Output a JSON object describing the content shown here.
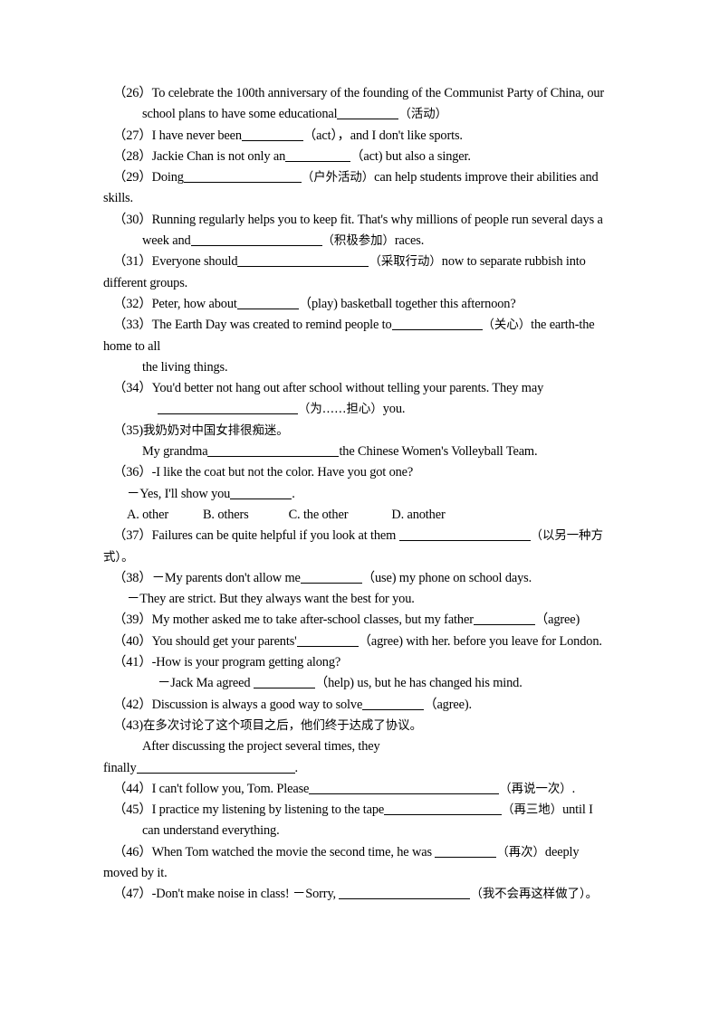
{
  "document": {
    "type": "english-grammar-worksheet",
    "page_background": "#ffffff",
    "text_color": "#000000"
  },
  "items": [
    {
      "number": "（26）",
      "lines": [
        {
          "indent": "ind1",
          "segments": [
            {
              "t": "text",
              "v": "（26）To celebrate the 100th anniversary of the founding of the Communist Party of China, our"
            }
          ]
        },
        {
          "indent": "ind2",
          "segments": [
            {
              "t": "text",
              "v": "school plans to have some educational"
            },
            {
              "t": "blank",
              "w": "b68"
            },
            {
              "t": "cn",
              "v": "（活动）"
            }
          ]
        }
      ]
    },
    {
      "number": "（27）",
      "lines": [
        {
          "indent": "ind1",
          "segments": [
            {
              "t": "text",
              "v": "（27）I have never been"
            },
            {
              "t": "blank",
              "w": "b68"
            },
            {
              "t": "text",
              "v": "（act），and I don't like sports."
            }
          ]
        }
      ]
    },
    {
      "number": "（28）",
      "lines": [
        {
          "indent": "ind1",
          "segments": [
            {
              "t": "text",
              "v": "（28）Jackie Chan is not only an"
            },
            {
              "t": "blank",
              "w": "b72"
            },
            {
              "t": "text",
              "v": "（act) but also a singer."
            }
          ]
        }
      ]
    },
    {
      "number": "（29）",
      "lines": [
        {
          "indent": "ind1",
          "segments": [
            {
              "t": "text",
              "v": "（29）Doing"
            },
            {
              "t": "blank",
              "w": "b130"
            },
            {
              "t": "cn",
              "v": "（户外活动）"
            },
            {
              "t": "text",
              "v": "can help students improve their abilities and"
            }
          ]
        },
        {
          "indent": "ind0",
          "segments": [
            {
              "t": "text",
              "v": "skills."
            }
          ]
        }
      ]
    },
    {
      "number": "（30）",
      "lines": [
        {
          "indent": "ind1",
          "segments": [
            {
              "t": "text",
              "v": "（30）Running regularly helps you to keep fit. That's why millions of people run several days a"
            }
          ]
        },
        {
          "indent": "ind2",
          "segments": [
            {
              "t": "text",
              "v": "week and"
            },
            {
              "t": "blank",
              "w": "b145"
            },
            {
              "t": "cn",
              "v": "（积极参加）"
            },
            {
              "t": "text",
              "v": "races."
            }
          ]
        }
      ]
    },
    {
      "number": "（31）",
      "lines": [
        {
          "indent": "ind1",
          "segments": [
            {
              "t": "text",
              "v": "（31）Everyone should"
            },
            {
              "t": "blank",
              "w": "b145"
            },
            {
              "t": "cn",
              "v": "（采取行动）"
            },
            {
              "t": "text",
              "v": "now to separate rubbish into"
            }
          ]
        },
        {
          "indent": "ind0",
          "segments": [
            {
              "t": "text",
              "v": "different groups."
            }
          ]
        }
      ]
    },
    {
      "number": "（32）",
      "lines": [
        {
          "indent": "ind1",
          "segments": [
            {
              "t": "text",
              "v": "（32）Peter, how about"
            },
            {
              "t": "blank",
              "w": "b68"
            },
            {
              "t": "text",
              "v": "（play) basketball together this afternoon?"
            }
          ]
        }
      ]
    },
    {
      "number": "（33）",
      "lines": [
        {
          "indent": "ind1",
          "segments": [
            {
              "t": "text",
              "v": "（33）The Earth Day was created to remind people to"
            },
            {
              "t": "blank",
              "w": "b100"
            },
            {
              "t": "cn",
              "v": "（关心）"
            },
            {
              "t": "text",
              "v": "the earth-the"
            }
          ]
        },
        {
          "indent": "ind0",
          "segments": [
            {
              "t": "text",
              "v": "home to all"
            }
          ]
        },
        {
          "indent": "ind2",
          "segments": [
            {
              "t": "text",
              "v": "the living things."
            }
          ]
        }
      ]
    },
    {
      "number": "（34）",
      "lines": [
        {
          "indent": "ind1",
          "segments": [
            {
              "t": "text",
              "v": "（34）You'd better not hang out after school without telling your parents. They may"
            }
          ]
        },
        {
          "indent": "ind3",
          "segments": [
            {
              "t": "blank",
              "w": "b155"
            },
            {
              "t": "cn",
              "v": "（为……担心）"
            },
            {
              "t": "text",
              "v": "you."
            }
          ]
        }
      ]
    },
    {
      "number": "（35）",
      "lines": [
        {
          "indent": "ind1",
          "segments": [
            {
              "t": "text",
              "v": "（35)"
            },
            {
              "t": "cn",
              "v": "我奶奶对中国女排很痴迷。"
            }
          ]
        },
        {
          "indent": "ind2",
          "segments": [
            {
              "t": "text",
              "v": "My grandma"
            },
            {
              "t": "blank",
              "w": "b145"
            },
            {
              "t": "text",
              "v": "the Chinese Women's Volleyball Team."
            }
          ]
        }
      ]
    },
    {
      "number": "（36）",
      "lines": [
        {
          "indent": "ind1",
          "segments": [
            {
              "t": "text",
              "v": "（36）-I like the coat but not the color. Have you got one?"
            }
          ]
        },
        {
          "indent": "ind4",
          "segments": [
            {
              "t": "text",
              "v": "－Yes, I'll show you"
            },
            {
              "t": "blank",
              "w": "b68"
            },
            {
              "t": "text",
              "v": "."
            }
          ]
        },
        {
          "indent": "ind4",
          "segments": [
            {
              "t": "text",
              "v": "A. other"
            },
            {
              "t": "gap",
              "w": "opt-gap"
            },
            {
              "t": "text",
              "v": "B. others"
            },
            {
              "t": "gap",
              "w": "opt-gap2"
            },
            {
              "t": "text",
              "v": "C. the other"
            },
            {
              "t": "gap",
              "w": "opt-gap3"
            },
            {
              "t": "text",
              "v": "D. another"
            }
          ]
        }
      ]
    },
    {
      "number": "（37）",
      "lines": [
        {
          "indent": "ind1",
          "segments": [
            {
              "t": "text",
              "v": "（37）Failures can be quite helpful if you look at them "
            },
            {
              "t": "blank",
              "w": "b145"
            },
            {
              "t": "cn",
              "v": "（以另一种方"
            }
          ]
        },
        {
          "indent": "ind0",
          "segments": [
            {
              "t": "cn",
              "v": "式）。"
            }
          ]
        }
      ]
    },
    {
      "number": "（38）",
      "lines": [
        {
          "indent": "ind1",
          "segments": [
            {
              "t": "text",
              "v": "（38）－My parents don't allow me"
            },
            {
              "t": "blank",
              "w": "b68"
            },
            {
              "t": "text",
              "v": "（use) my phone on school days."
            }
          ]
        },
        {
          "indent": "ind4",
          "segments": [
            {
              "t": "text",
              "v": "－They are strict. But they always want the best for you."
            }
          ]
        }
      ]
    },
    {
      "number": "（39）",
      "lines": [
        {
          "indent": "ind1",
          "segments": [
            {
              "t": "text",
              "v": "（39）My mother asked me to take after-school classes, but my father"
            },
            {
              "t": "blank",
              "w": "b68"
            },
            {
              "t": "text",
              "v": "（agree)"
            }
          ]
        }
      ]
    },
    {
      "number": "（40）",
      "lines": [
        {
          "indent": "ind1",
          "segments": [
            {
              "t": "text",
              "v": "（40）You should get your parents'"
            },
            {
              "t": "blank",
              "w": "b68"
            },
            {
              "t": "text",
              "v": "（agree) with her. before you leave for London."
            }
          ]
        }
      ]
    },
    {
      "number": "（41）",
      "lines": [
        {
          "indent": "ind1",
          "segments": [
            {
              "t": "text",
              "v": "（41）-How is your program getting along?"
            }
          ]
        },
        {
          "indent": "ind3",
          "segments": [
            {
              "t": "text",
              "v": "－Jack Ma agreed "
            },
            {
              "t": "blank",
              "w": "b68"
            },
            {
              "t": "text",
              "v": "（help) us, but he has changed his mind."
            }
          ]
        }
      ]
    },
    {
      "number": "（42）",
      "lines": [
        {
          "indent": "ind1",
          "segments": [
            {
              "t": "text",
              "v": "（42）Discussion is always a good way to solve"
            },
            {
              "t": "blank",
              "w": "b68"
            },
            {
              "t": "text",
              "v": "（agree)."
            }
          ]
        }
      ]
    },
    {
      "number": "（43）",
      "lines": [
        {
          "indent": "ind1",
          "segments": [
            {
              "t": "text",
              "v": "（43)"
            },
            {
              "t": "cn",
              "v": "在多次讨论了这个项目之后，他们终于达成了协议。"
            }
          ]
        },
        {
          "indent": "ind2",
          "segments": [
            {
              "t": "text",
              "v": "After discussing the project several times, they"
            }
          ]
        },
        {
          "indent": "ind0",
          "segments": [
            {
              "t": "text",
              "v": "finally"
            },
            {
              "t": "blank",
              "w": "b175"
            },
            {
              "t": "text",
              "v": "."
            }
          ]
        }
      ]
    },
    {
      "number": "（44）",
      "lines": [
        {
          "indent": "ind1",
          "segments": [
            {
              "t": "text",
              "v": "（44）I can't follow you, Tom. Please"
            },
            {
              "t": "blank",
              "w": "b210"
            },
            {
              "t": "cn",
              "v": "（再说一次）"
            },
            {
              "t": "text",
              "v": "."
            }
          ]
        }
      ]
    },
    {
      "number": "（45）",
      "lines": [
        {
          "indent": "ind1",
          "segments": [
            {
              "t": "text",
              "v": "（45）I practice my listening by listening to the tape"
            },
            {
              "t": "blank",
              "w": "b130"
            },
            {
              "t": "cn",
              "v": "（再三地）"
            },
            {
              "t": "text",
              "v": "until I"
            }
          ]
        },
        {
          "indent": "ind2",
          "segments": [
            {
              "t": "text",
              "v": "can understand everything."
            }
          ]
        }
      ]
    },
    {
      "number": "（46）",
      "lines": [
        {
          "indent": "ind1",
          "segments": [
            {
              "t": "text",
              "v": "（46）When Tom watched the movie the second time, he was "
            },
            {
              "t": "blank",
              "w": "b68"
            },
            {
              "t": "cn",
              "v": "（再次）"
            },
            {
              "t": "text",
              "v": "deeply"
            }
          ]
        },
        {
          "indent": "ind0",
          "segments": [
            {
              "t": "text",
              "v": "moved by it."
            }
          ]
        }
      ]
    },
    {
      "number": "（47）",
      "lines": [
        {
          "indent": "ind1",
          "segments": [
            {
              "t": "text",
              "v": "（47）-Don't make noise in class!  －Sorry, "
            },
            {
              "t": "blank",
              "w": "b145"
            },
            {
              "t": "cn",
              "v": "（我不会再这样做了）。"
            }
          ]
        }
      ]
    }
  ]
}
